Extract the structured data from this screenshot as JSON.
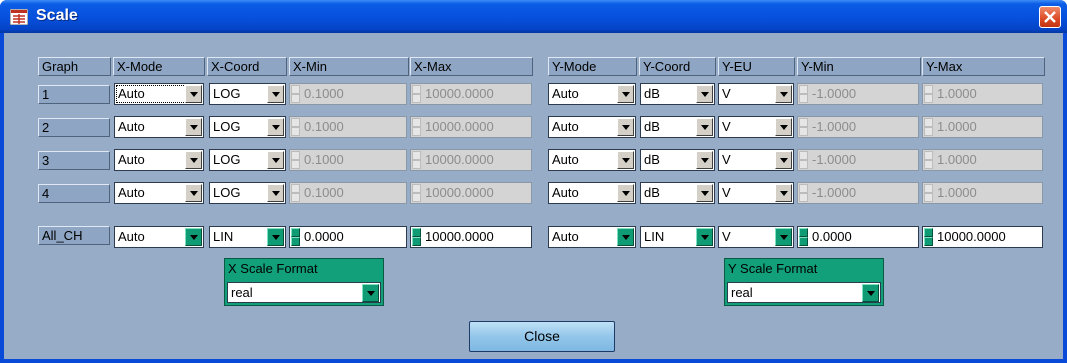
{
  "window": {
    "title": "Scale"
  },
  "headers": {
    "graph": "Graph",
    "x_mode": "X-Mode",
    "x_coord": "X-Coord",
    "x_min": "X-Min",
    "x_max": "X-Max",
    "y_mode": "Y-Mode",
    "y_coord": "Y-Coord",
    "y_eu": "Y-EU",
    "y_min": "Y-Min",
    "y_max": "Y-Max"
  },
  "rows": [
    {
      "graph": "1",
      "x_mode": "Auto",
      "x_coord": "LOG",
      "x_min": "0.1000",
      "x_max": "10000.0000",
      "y_mode": "Auto",
      "y_coord": "dB",
      "y_eu": "V",
      "y_min": "-1.0000",
      "y_max": "1.0000"
    },
    {
      "graph": "2",
      "x_mode": "Auto",
      "x_coord": "LOG",
      "x_min": "0.1000",
      "x_max": "10000.0000",
      "y_mode": "Auto",
      "y_coord": "dB",
      "y_eu": "V",
      "y_min": "-1.0000",
      "y_max": "1.0000"
    },
    {
      "graph": "3",
      "x_mode": "Auto",
      "x_coord": "LOG",
      "x_min": "0.1000",
      "x_max": "10000.0000",
      "y_mode": "Auto",
      "y_coord": "dB",
      "y_eu": "V",
      "y_min": "-1.0000",
      "y_max": "1.0000"
    },
    {
      "graph": "4",
      "x_mode": "Auto",
      "x_coord": "LOG",
      "x_min": "0.1000",
      "x_max": "10000.0000",
      "y_mode": "Auto",
      "y_coord": "dB",
      "y_eu": "V",
      "y_min": "-1.0000",
      "y_max": "1.0000"
    }
  ],
  "all_ch": {
    "graph": "All_CH",
    "x_mode": "Auto",
    "x_coord": "LIN",
    "x_min": "0.0000",
    "x_max": "10000.0000",
    "y_mode": "Auto",
    "y_coord": "LIN",
    "y_eu": "V",
    "y_min": "0.0000",
    "y_max": "10000.0000"
  },
  "x_scale_format": {
    "label": "X Scale Format",
    "value": "real"
  },
  "y_scale_format": {
    "label": "Y Scale Format",
    "value": "real"
  },
  "buttons": {
    "close": "Close"
  },
  "colors": {
    "title_bar": "#0650dc",
    "client_bg": "#97acc6",
    "accent_green": "#11a07a",
    "close_button": "#93c6ea",
    "window_close": "#dc4a24"
  },
  "icons": {
    "window": "scale-app-icon",
    "close": "close-icon",
    "dropdown": "chevron-down-icon",
    "spinner": "spinner-updown-icon"
  }
}
